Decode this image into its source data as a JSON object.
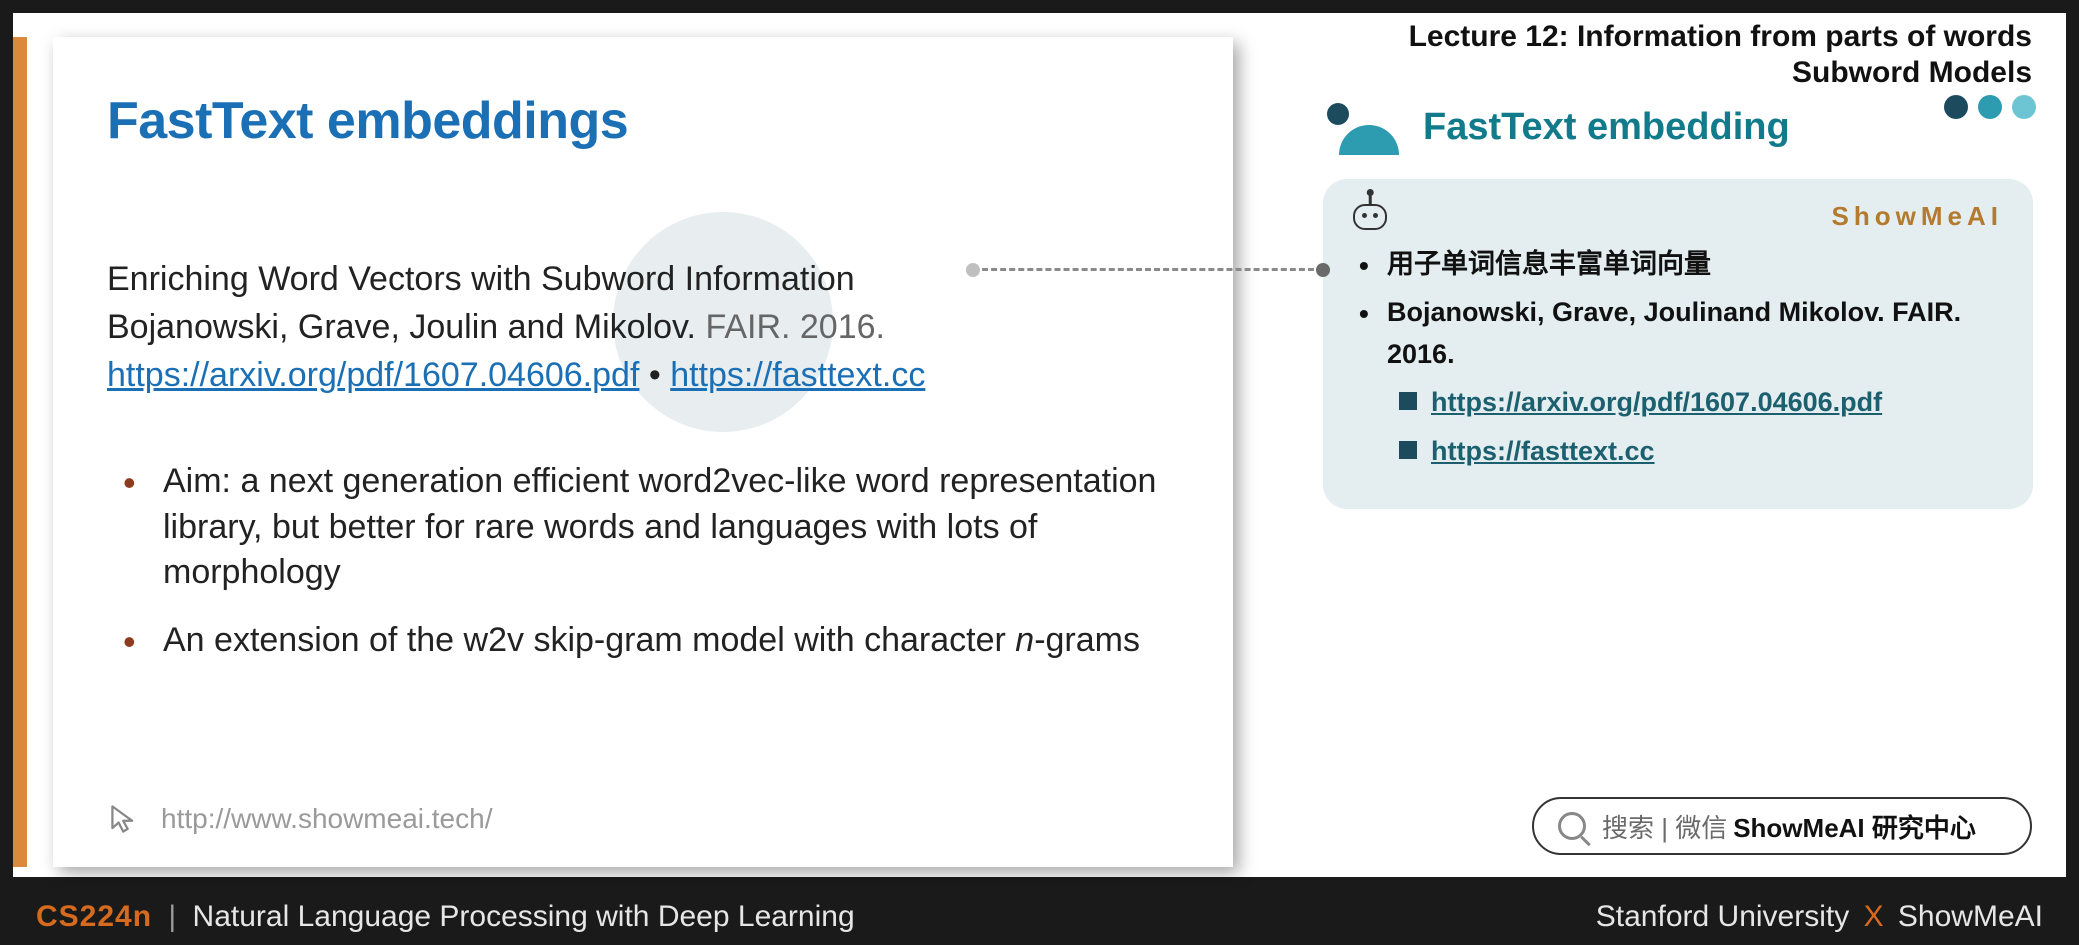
{
  "header": {
    "line1": "Lecture 12: Information from parts of words",
    "line2": "Subword Models"
  },
  "slide": {
    "title": "FastText embeddings",
    "citation_line1": "Enriching Word Vectors with Subword Information",
    "citation_line2_a": "Bojanowski, Grave, Joulin and Mikolov.",
    "citation_line2_b": "FAIR. 2016.",
    "link1": "https://arxiv.org/pdf/1607.04606.pdf",
    "sep": "•",
    "link2": "https://fasttext.cc",
    "bullet1": "Aim: a next generation efficient word2vec-like word representation library, but better for rare words and languages with lots of morphology",
    "bullet2_a": "An extension of the w2v skip-gram model with character ",
    "bullet2_b": "n",
    "bullet2_c": "-grams",
    "footer_url": "http://www.showmeai.tech/"
  },
  "section": {
    "title": "FastText embedding"
  },
  "card": {
    "brand": "ShowMeAI",
    "item1": "用子单词信息丰富单词向量",
    "item2": "Bojanowski, Grave, Joulinand Mikolov. FAIR. 2016.",
    "sublink1": "https://arxiv.org/pdf/1607.04606.pdf",
    "sublink2": "https://fasttext.cc"
  },
  "search": {
    "prefix": "搜索 | 微信",
    "bold": "ShowMeAI 研究中心"
  },
  "footer": {
    "code": "CS224n",
    "sep": "|",
    "course": "Natural Language Processing with Deep Learning",
    "right_a": "Stanford University",
    "right_x": "X",
    "right_b": "ShowMeAI"
  }
}
